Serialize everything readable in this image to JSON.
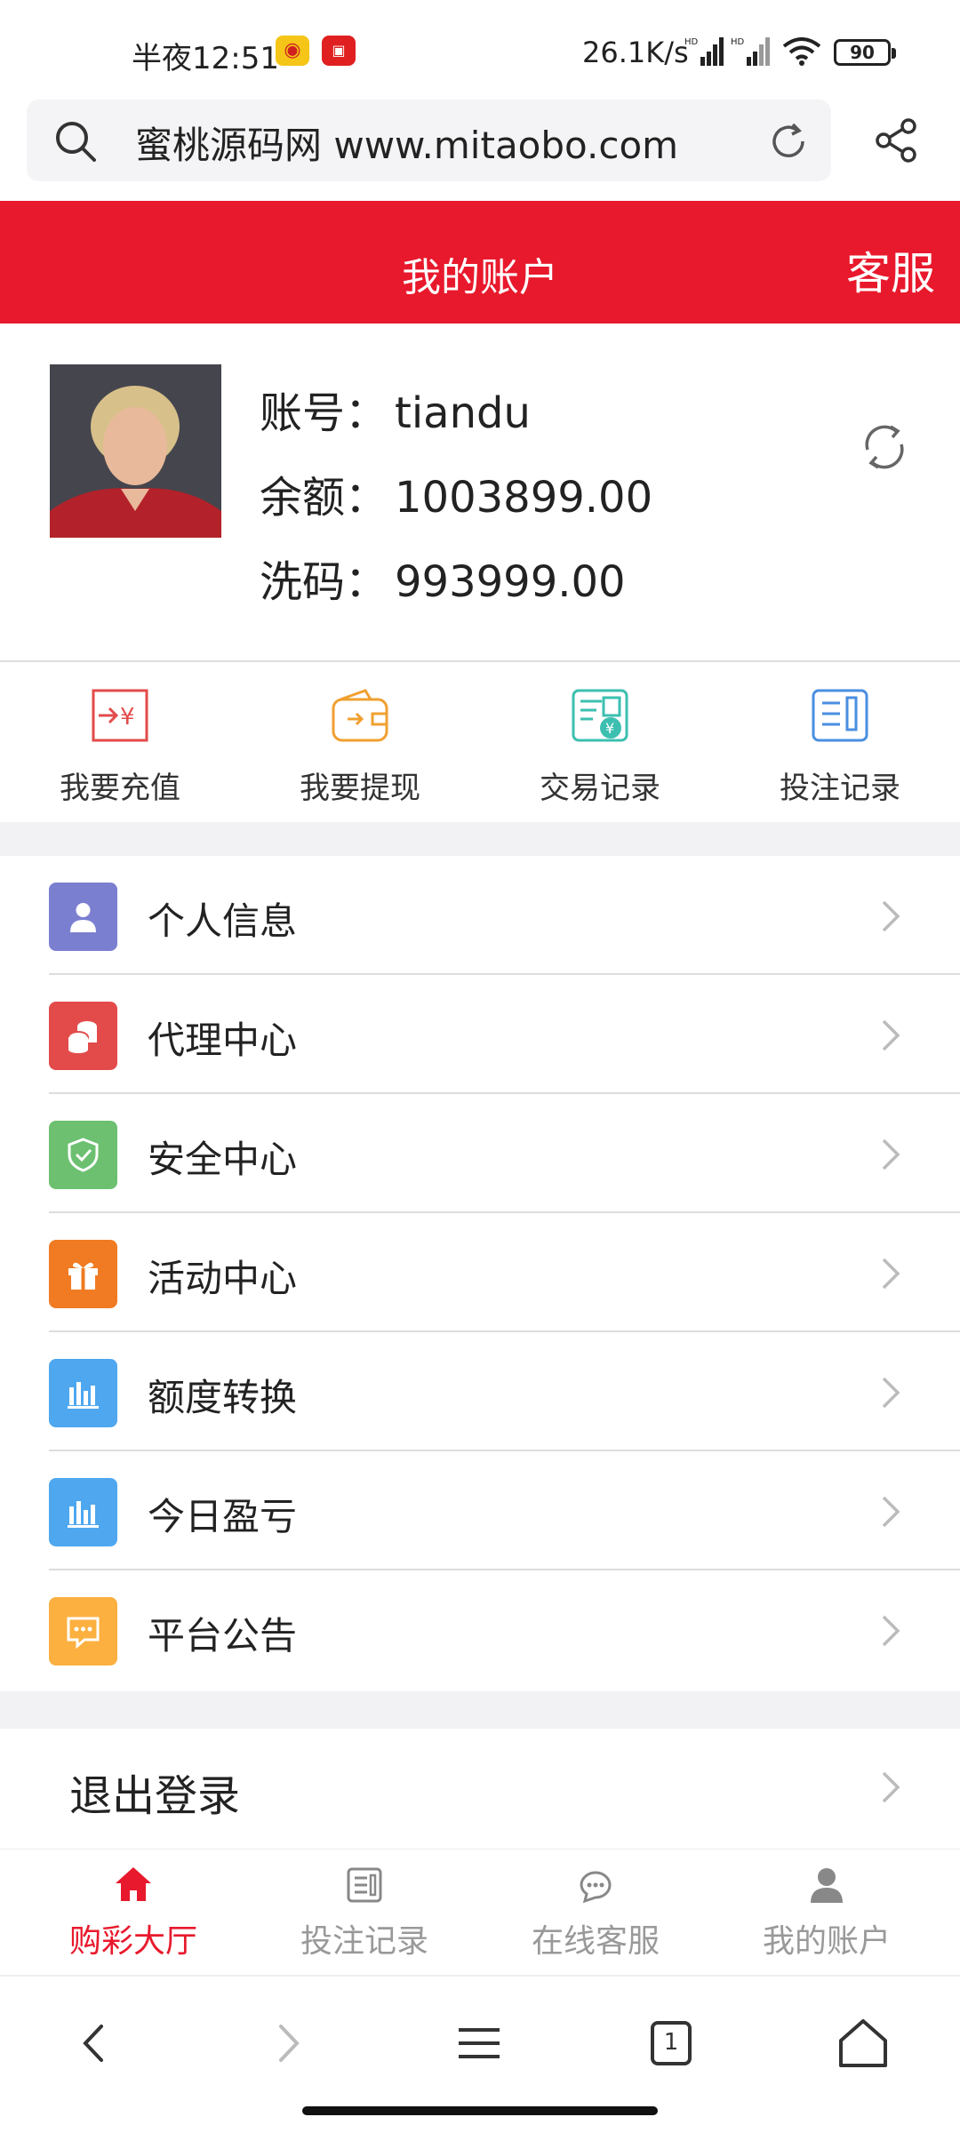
{
  "status_bar": {
    "time": "半夜12:51",
    "speed": "26.1K/s",
    "battery": "90"
  },
  "address_bar": {
    "url_text": "蜜桃源码网 www.mitaobo.com"
  },
  "header": {
    "title": "我的账户",
    "service_label": "客服"
  },
  "account": {
    "username_label": "账号：",
    "username": "tiandu",
    "balance_label": "余额：",
    "balance": "1003899.00",
    "wash_label": "洗码：",
    "wash": "993999.00"
  },
  "quick_actions": [
    {
      "label": "我要充值",
      "icon": "recharge-icon"
    },
    {
      "label": "我要提现",
      "icon": "wallet-icon"
    },
    {
      "label": "交易记录",
      "icon": "transaction-record-icon"
    },
    {
      "label": "投注记录",
      "icon": "bet-record-icon"
    }
  ],
  "menu": [
    {
      "label": "个人信息",
      "icon": "user-icon",
      "color": "#7b7fd0"
    },
    {
      "label": "代理中心",
      "icon": "coins-icon",
      "color": "#e34b4b"
    },
    {
      "label": "安全中心",
      "icon": "shield-icon",
      "color": "#6cc070"
    },
    {
      "label": "活动中心",
      "icon": "gift-icon",
      "color": "#f07b22"
    },
    {
      "label": "额度转换",
      "icon": "bar-chart-icon",
      "color": "#4ea7ef"
    },
    {
      "label": "今日盈亏",
      "icon": "bar-chart-icon",
      "color": "#4ea7ef"
    },
    {
      "label": "平台公告",
      "icon": "message-icon",
      "color": "#fbb040"
    }
  ],
  "logout_label": "退出登录",
  "tabbar": [
    {
      "label": "购彩大厅",
      "icon": "home-icon",
      "active": true
    },
    {
      "label": "投注记录",
      "icon": "document-icon",
      "active": false
    },
    {
      "label": "在线客服",
      "icon": "chat-icon",
      "active": false
    },
    {
      "label": "我的账户",
      "icon": "person-icon",
      "active": false
    }
  ],
  "browser_nav": {
    "tab_count": "1"
  },
  "colors": {
    "brand_red": "#e8192c"
  }
}
